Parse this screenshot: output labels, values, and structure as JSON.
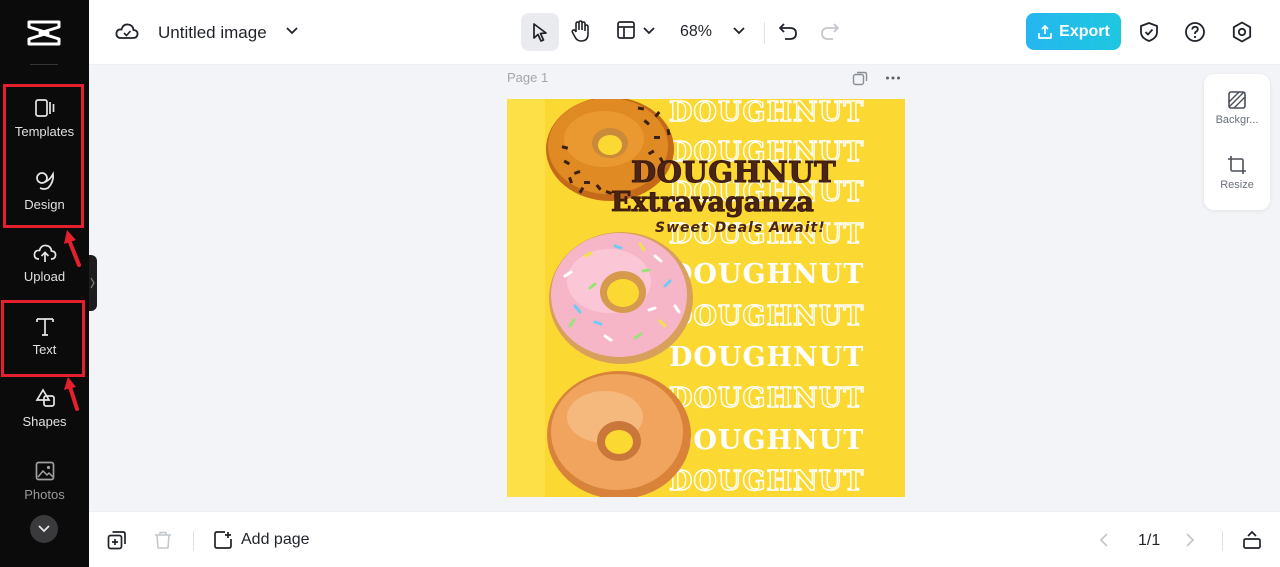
{
  "sidebar": {
    "items": [
      {
        "label": "Templates",
        "icon": "templates-icon"
      },
      {
        "label": "Design",
        "icon": "design-icon"
      },
      {
        "label": "Upload",
        "icon": "upload-icon"
      },
      {
        "label": "Text",
        "icon": "text-icon"
      },
      {
        "label": "Shapes",
        "icon": "shapes-icon"
      },
      {
        "label": "Photos",
        "icon": "photos-icon"
      }
    ]
  },
  "header": {
    "title": "Untitled image",
    "zoom": "68%",
    "export_label": "Export"
  },
  "canvas": {
    "page_label": "Page 1",
    "headline_line1": "DOUGHNUT",
    "headline_line2": "Extravaganza",
    "tagline": "Sweet Deals Await!",
    "watermark_word": "DOUGHNUT"
  },
  "side_panel": {
    "background_label": "Backgr...",
    "resize_label": "Resize"
  },
  "footer": {
    "add_page_label": "Add page",
    "page_count": "1/1"
  },
  "colors": {
    "accent": "#1ec7e0",
    "highlight": "#e5202e",
    "canvas_bg": "#fde047",
    "headline": "#4a2414"
  }
}
